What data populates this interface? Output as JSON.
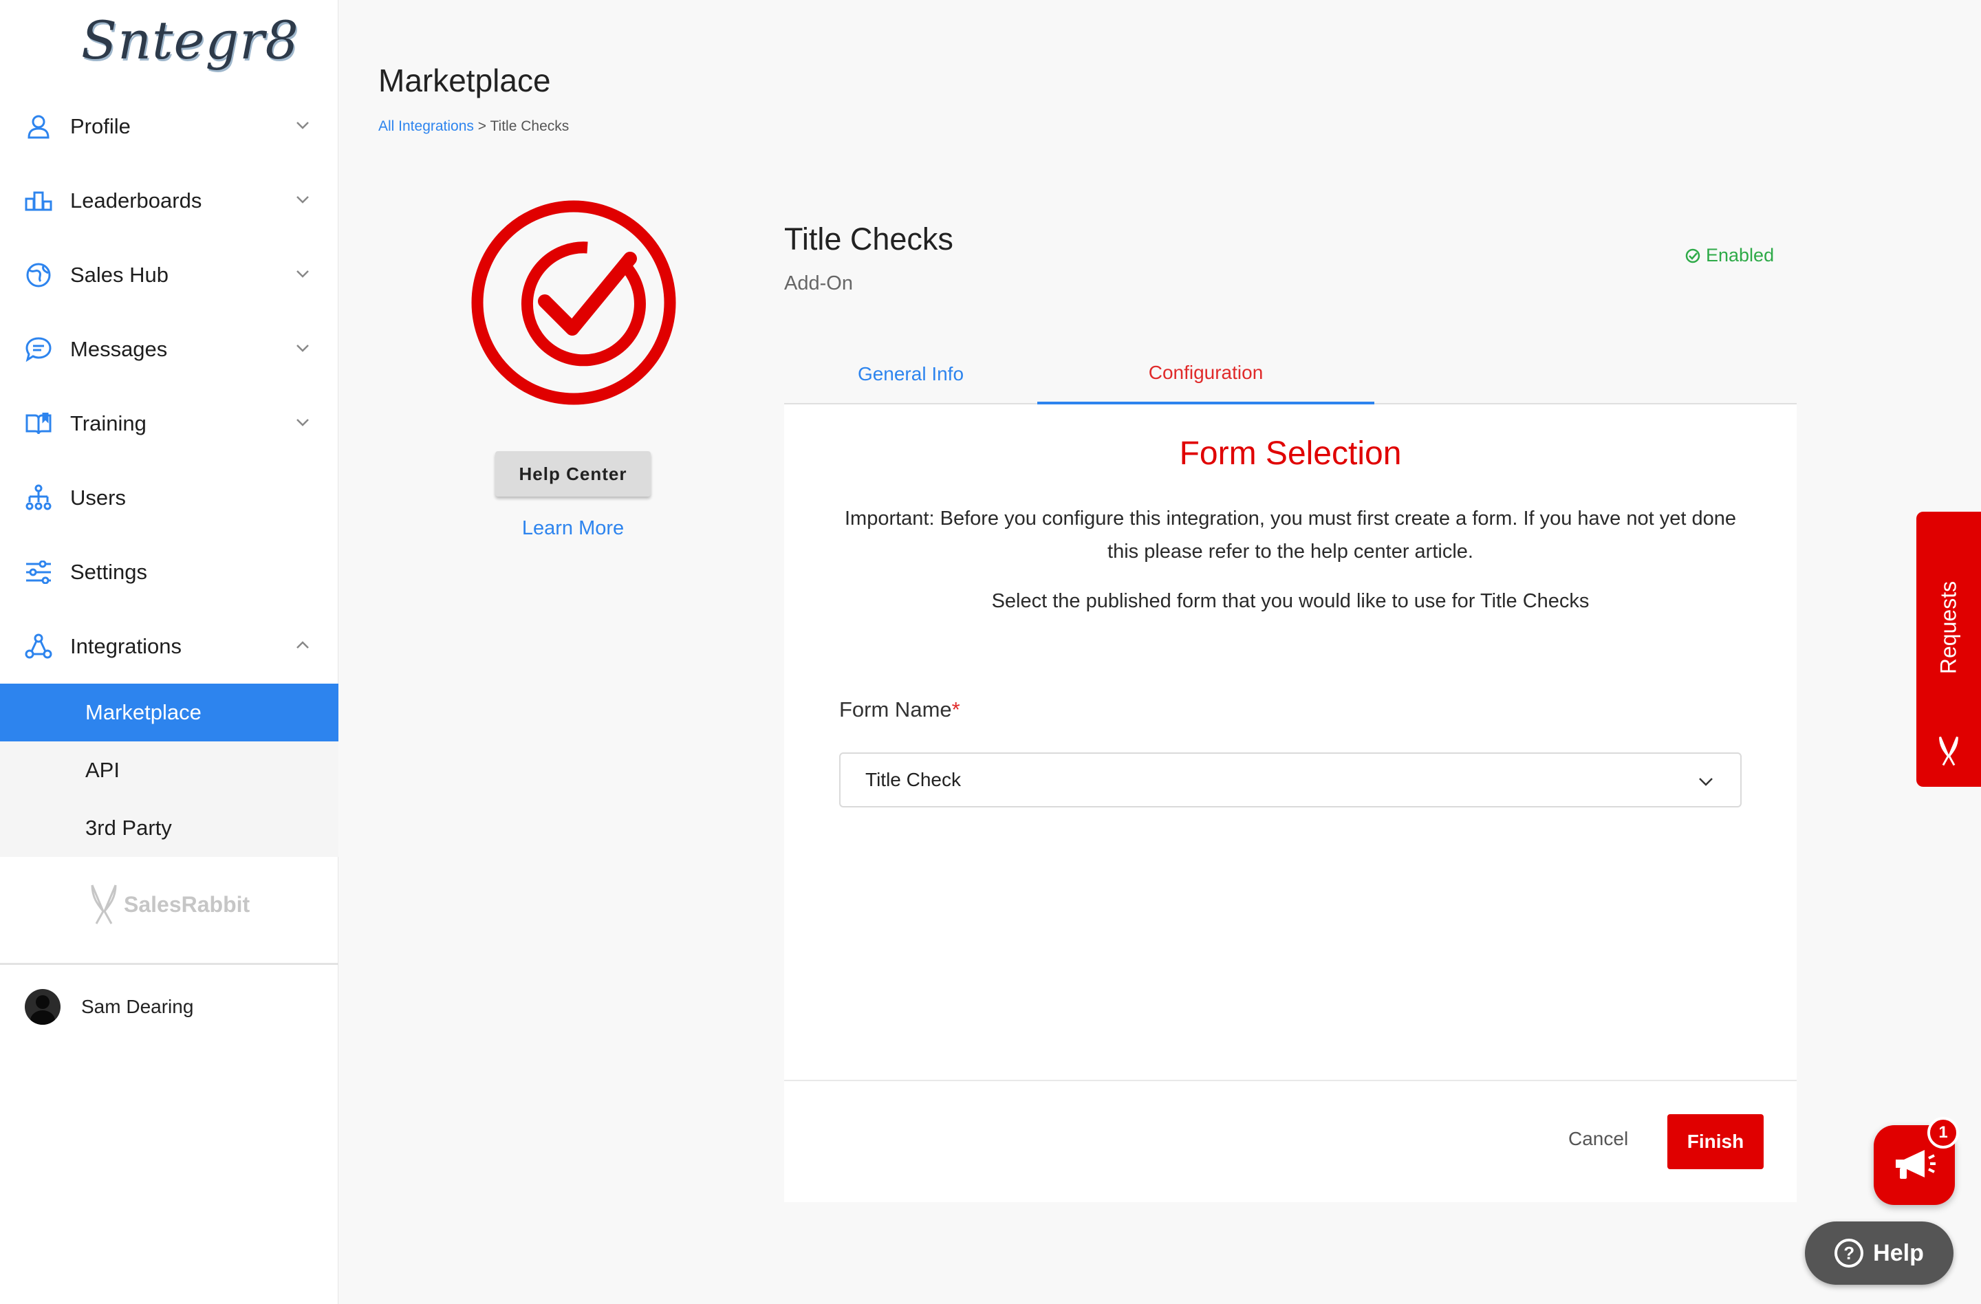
{
  "sidebar": {
    "logo_text": "Sntegr8",
    "items": [
      {
        "label": "Profile"
      },
      {
        "label": "Leaderboards"
      },
      {
        "label": "Sales Hub"
      },
      {
        "label": "Messages"
      },
      {
        "label": "Training"
      },
      {
        "label": "Users"
      },
      {
        "label": "Settings"
      },
      {
        "label": "Integrations"
      }
    ],
    "sub_items": [
      {
        "label": "Marketplace"
      },
      {
        "label": "API"
      },
      {
        "label": "3rd Party"
      }
    ],
    "footer_logo": "SalesRabbit",
    "user_name": "Sam Dearing"
  },
  "header": {
    "title": "Marketplace",
    "breadcrumb_link": "All Integrations",
    "breadcrumb_sep": ">",
    "breadcrumb_current": "Title Checks"
  },
  "integration": {
    "help_center": "Help Center",
    "learn_more": "Learn More",
    "title": "Title Checks",
    "subtitle": "Add-On",
    "status": "Enabled",
    "status_color": "#2eaa48",
    "brand_color": "#e00000"
  },
  "tabs": [
    {
      "label": "General Info"
    },
    {
      "label": "Configuration"
    }
  ],
  "form": {
    "heading": "Form Selection",
    "important": "Important: Before you configure this integration, you must first create a form. If you have not yet done this please refer to the help center article.",
    "instruction": "Select the published form that you would like to use for Title Checks",
    "field_label": "Form Name",
    "required_marker": "*",
    "selected_value": "Title Check",
    "cancel": "Cancel",
    "finish": "Finish"
  },
  "floating": {
    "requests": "Requests",
    "badge_count": "1",
    "help": "Help",
    "help_icon": "?"
  }
}
